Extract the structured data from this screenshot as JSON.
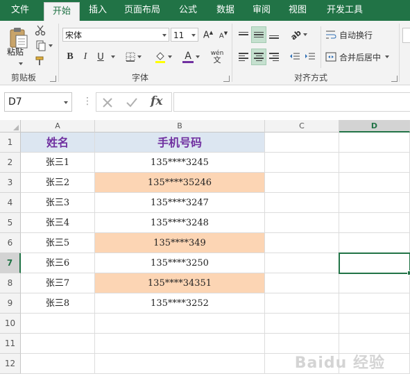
{
  "ribbon_tabs": [
    "文件",
    "开始",
    "插入",
    "页面布局",
    "公式",
    "数据",
    "审阅",
    "视图",
    "开发工具"
  ],
  "active_tab": "开始",
  "clipboard": {
    "paste_label": "粘贴",
    "group_label": "剪贴板"
  },
  "font": {
    "name": "宋体",
    "size": "11",
    "bold": "B",
    "italic": "I",
    "underline": "U",
    "font_color_glyph": "A",
    "phonetic_glyph": "wén",
    "group_label": "字体"
  },
  "alignment": {
    "wrap_label": "自动换行",
    "merge_label": "合并后居中",
    "group_label": "对齐方式"
  },
  "formula_bar": {
    "name_box": "D7",
    "fx": "fx",
    "formula": ""
  },
  "colors": {
    "accent": "#217346",
    "header_fill": "#dce6f1",
    "header_text": "#7030a0",
    "highlight_fill": "#fcd5b4"
  },
  "columns": [
    "A",
    "B",
    "C",
    "D"
  ],
  "selected_column": "D",
  "selected_row": "7",
  "rows": [
    "1",
    "2",
    "3",
    "4",
    "5",
    "6",
    "7",
    "8",
    "9",
    "10",
    "11",
    "12"
  ],
  "table": {
    "headers": [
      "姓名",
      "手机号码"
    ],
    "data": [
      {
        "name": "张三1",
        "phone": "135****3245",
        "highlight": false
      },
      {
        "name": "张三2",
        "phone": "135****35246",
        "highlight": true
      },
      {
        "name": "张三3",
        "phone": "135****3247",
        "highlight": false
      },
      {
        "name": "张三4",
        "phone": "135****3248",
        "highlight": false
      },
      {
        "name": "张三5",
        "phone": "135****349",
        "highlight": true
      },
      {
        "name": "张三6",
        "phone": "135****3250",
        "highlight": false
      },
      {
        "name": "张三7",
        "phone": "135****34351",
        "highlight": true
      },
      {
        "name": "张三8",
        "phone": "135****3252",
        "highlight": false
      }
    ]
  }
}
